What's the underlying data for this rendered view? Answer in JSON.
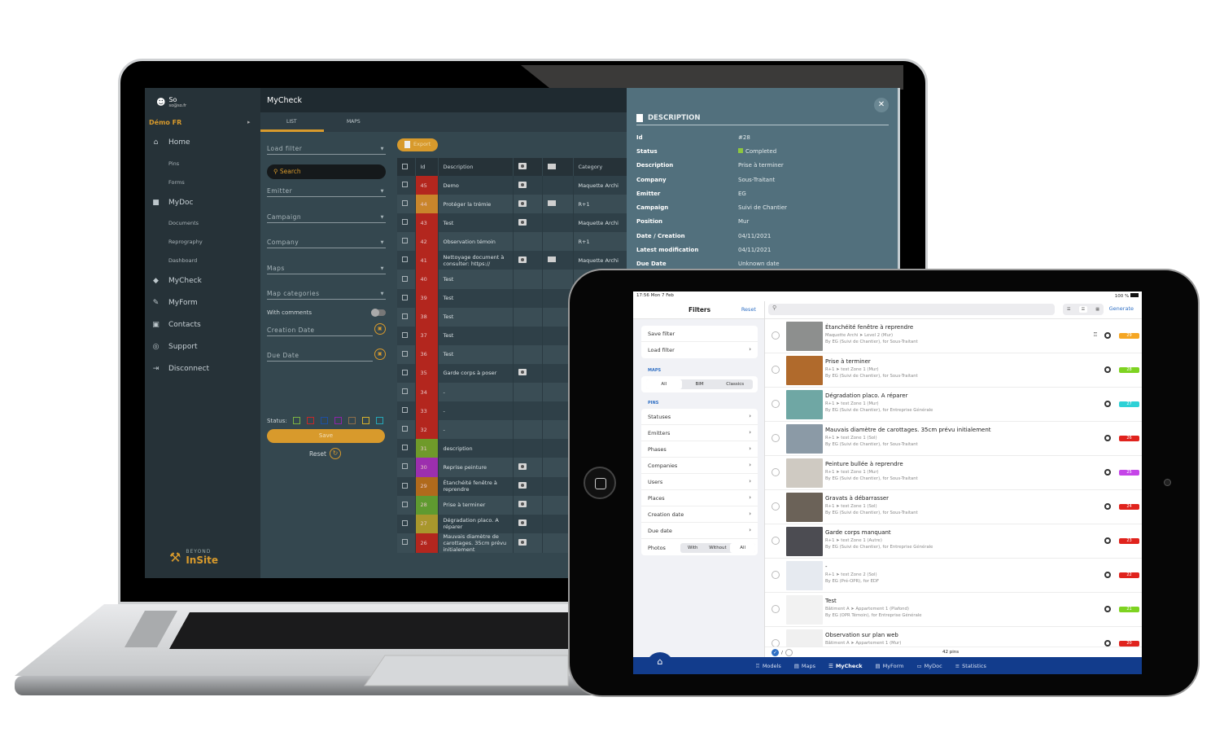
{
  "laptop": {
    "sidebar": {
      "user_name": "So",
      "user_email": "so@so.fr",
      "project": "Démo FR",
      "items": [
        {
          "label": "Home",
          "icon": "home-icon",
          "level": 0
        },
        {
          "label": "Pins",
          "level": 1
        },
        {
          "label": "Forms",
          "level": 1
        },
        {
          "label": "MyDoc",
          "icon": "folder-icon",
          "level": 0
        },
        {
          "label": "Documents",
          "level": 1
        },
        {
          "label": "Reprography",
          "level": 1
        },
        {
          "label": "Dashboard",
          "level": 1
        },
        {
          "label": "MyCheck",
          "icon": "shield-check-icon",
          "level": 0
        },
        {
          "label": "MyForm",
          "icon": "pencil-icon",
          "level": 0
        },
        {
          "label": "Contacts",
          "icon": "contact-card-icon",
          "level": 0
        },
        {
          "label": "Support",
          "icon": "lifebuoy-icon",
          "level": 0
        },
        {
          "label": "Disconnect",
          "icon": "logout-icon",
          "level": 0
        }
      ],
      "brand_top": "BEYOND",
      "brand_main": "InSite"
    },
    "header": {
      "title": "MyCheck"
    },
    "tabs": [
      {
        "label": "LIST",
        "active": true
      },
      {
        "label": "MAPS",
        "active": false
      }
    ],
    "filters": {
      "load_filter": "Load filter",
      "search_placeholder": "Search",
      "emitter": "Emitter",
      "campaign": "Campaign",
      "company": "Company",
      "maps": "Maps",
      "map_categories": "Map categories",
      "with_comments": "With comments",
      "creation_date": "Creation Date",
      "due_date": "Due Date",
      "status_label": "Status:",
      "status_colors": [
        "#7cb342",
        "#c62828",
        "#1e4fa3",
        "#8e24aa",
        "#8d6e4a",
        "#d8b12c",
        "#26a6b8"
      ],
      "save_label": "Save",
      "reset_label": "Reset"
    },
    "table": {
      "export_label": "Export",
      "columns": [
        "Id",
        "Description",
        "photo",
        "comment",
        "Category"
      ],
      "rows": [
        {
          "id": "45",
          "color": "#b3261e",
          "description": "Demo",
          "photo": true,
          "comment": false,
          "category": "Maquette Archi"
        },
        {
          "id": "44",
          "color": "#c9852b",
          "description": "Protéger la trémie",
          "photo": true,
          "comment": true,
          "category": "R+1"
        },
        {
          "id": "43",
          "color": "#b3261e",
          "description": "Test",
          "photo": true,
          "comment": false,
          "category": "Maquette Archi"
        },
        {
          "id": "42",
          "color": "#b3261e",
          "description": "Observation témoin",
          "photo": false,
          "comment": false,
          "category": "R+1"
        },
        {
          "id": "41",
          "color": "#b3261e",
          "description": "Nettoyage document à consulter: https://",
          "photo": true,
          "comment": true,
          "category": "Maquette Archi"
        },
        {
          "id": "40",
          "color": "#b3261e",
          "description": "Test",
          "photo": false,
          "comment": false,
          "category": ""
        },
        {
          "id": "39",
          "color": "#b3261e",
          "description": "Test",
          "photo": false,
          "comment": false,
          "category": ""
        },
        {
          "id": "38",
          "color": "#b3261e",
          "description": "Test",
          "photo": false,
          "comment": false,
          "category": ""
        },
        {
          "id": "37",
          "color": "#b3261e",
          "description": "Test",
          "photo": false,
          "comment": false,
          "category": ""
        },
        {
          "id": "36",
          "color": "#b3261e",
          "description": "Test",
          "photo": false,
          "comment": false,
          "category": ""
        },
        {
          "id": "35",
          "color": "#b3261e",
          "description": "Garde corps à poser",
          "photo": true,
          "comment": false,
          "category": ""
        },
        {
          "id": "34",
          "color": "#b3261e",
          "description": "-",
          "photo": false,
          "comment": false,
          "category": ""
        },
        {
          "id": "33",
          "color": "#b3261e",
          "description": "-",
          "photo": false,
          "comment": false,
          "category": ""
        },
        {
          "id": "32",
          "color": "#b3261e",
          "description": "-",
          "photo": false,
          "comment": false,
          "category": ""
        },
        {
          "id": "31",
          "color": "#6f9a2a",
          "description": "description",
          "photo": false,
          "comment": false,
          "category": ""
        },
        {
          "id": "30",
          "color": "#9c2fae",
          "description": "Reprise peinture",
          "photo": true,
          "comment": false,
          "category": ""
        },
        {
          "id": "29",
          "color": "#b06a1c",
          "description": "Étanchéité fenêtre à reprendre",
          "photo": true,
          "comment": false,
          "category": ""
        },
        {
          "id": "28",
          "color": "#5f9a30",
          "description": "Prise à terminer",
          "photo": true,
          "comment": false,
          "category": ""
        },
        {
          "id": "27",
          "color": "#a8972c",
          "description": "Dégradation placo. A réparer",
          "photo": true,
          "comment": false,
          "category": ""
        },
        {
          "id": "26",
          "color": "#b3261e",
          "description": "Mauvais diamètre de carottages. 35cm prévu initialement",
          "photo": true,
          "comment": false,
          "category": ""
        }
      ]
    },
    "description_panel": {
      "title": "DESCRIPTION",
      "fields": [
        {
          "key": "Id",
          "value": "#28"
        },
        {
          "key": "Status",
          "value": "Completed",
          "status_color": "#8dc63f"
        },
        {
          "key": "Description",
          "value": "Prise à terminer"
        },
        {
          "key": "Company",
          "value": "Sous-Traitant"
        },
        {
          "key": "Emitter",
          "value": "EG"
        },
        {
          "key": "Campaign",
          "value": "Suivi de Chantier"
        },
        {
          "key": "Position",
          "value": "Mur"
        },
        {
          "key": "Date / Creation",
          "value": "04/11/2021"
        },
        {
          "key": "Latest modification",
          "value": "04/11/2021"
        },
        {
          "key": "Due Date",
          "value": "Unknown date"
        }
      ]
    }
  },
  "ipad": {
    "status_time": "17:56  Mon 7 Feb",
    "battery": "100 %",
    "filters": {
      "title": "Filters",
      "reset": "Reset",
      "save_filter": "Save filter",
      "load_filter": "Load filter",
      "maps_section": "MAPS",
      "maps_options": [
        "All",
        "BIM",
        "Classics"
      ],
      "maps_selected": "All",
      "pins_section": "PINS",
      "pins_items": [
        "Statuses",
        "Emitters",
        "Phases",
        "Companies",
        "Users",
        "Places",
        "Creation date",
        "Due date"
      ],
      "photos_label": "Photos",
      "photos_options": [
        "With",
        "Without",
        "All"
      ],
      "photos_selected": "All"
    },
    "list": {
      "generate": "Generate",
      "items": [
        {
          "title": "Étanchéité fenêtre à reprendre",
          "location": "Maquette Archi ➤ Level 2 (Mur)",
          "by": "By EG (Suivi de Chantier), for Sous-Traitant",
          "badge": "29",
          "color": "#f5a623",
          "model": true,
          "thumb": "#8d8f8e"
        },
        {
          "title": "Prise à terminer",
          "location": "R+1 ➤ test Zone 1 (Mur)",
          "by": "By EG (Suivi de Chantier), for Sous-Traitant",
          "badge": "28",
          "color": "#7ed321",
          "model": false,
          "thumb": "#b06a2c"
        },
        {
          "title": "Dégradation placo. A réparer",
          "location": "R+1 ➤ test Zone 1 (Mur)",
          "by": "By EG (Suivi de Chantier), for Entreprise Générale",
          "badge": "27",
          "color": "#2ed1d6",
          "model": false,
          "thumb": "#6fa7a4"
        },
        {
          "title": "Mauvais diamètre de carottages. 35cm prévu initialement",
          "location": "R+1 ➤ test Zone 1 (Sol)",
          "by": "By EG (Suivi de Chantier), for Sous-Traitant",
          "badge": "26",
          "color": "#e0231d",
          "model": false,
          "thumb": "#8b9aa6"
        },
        {
          "title": "Peinture bullée à reprendre",
          "location": "R+1 ➤ test Zone 1 (Mur)",
          "by": "By EG (Suivi de Chantier), for Sous-Traitant",
          "badge": "25",
          "color": "#c545e8",
          "model": false,
          "thumb": "#cfcac2"
        },
        {
          "title": "Gravats à débarrasser",
          "location": "R+1 ➤ test Zone 1 (Sol)",
          "by": "By EG (Suivi de Chantier), for Sous-Traitant",
          "badge": "24",
          "color": "#e0231d",
          "model": false,
          "thumb": "#6b6258"
        },
        {
          "title": "Garde corps manquant",
          "location": "R+1 ➤ test Zone 1 (Autre)",
          "by": "By EG (Suivi de Chantier), for Entreprise Générale",
          "badge": "23",
          "color": "#e0231d",
          "model": false,
          "thumb": "#4c4c52"
        },
        {
          "title": "-",
          "location": "R+1 ➤ test Zone 2 (Sol)",
          "by": "By EG (Pré-OPR), for EDF",
          "badge": "22",
          "color": "#e0231d",
          "model": false,
          "thumb": "#e6eaf0"
        },
        {
          "title": "Test",
          "location": "Bâtiment A ➤ Appartement 1 (Plafond)",
          "by": "By EG (OPR Témoin), for Entreprise Générale",
          "badge": "21",
          "color": "#7ed321",
          "model": false,
          "thumb": "#f2f2f2"
        },
        {
          "title": "Observation sur plan web",
          "location": "Bâtiment A ➤ Appartement 1 (Mur)",
          "by": "",
          "badge": "20",
          "color": "#e0231d",
          "model": false,
          "thumb": "#f0f0f0"
        }
      ],
      "count": "42 pins"
    },
    "tabbar": [
      {
        "label": "Models",
        "icon": "building-icon",
        "active": false
      },
      {
        "label": "Maps",
        "icon": "map-icon",
        "active": false
      },
      {
        "label": "MyCheck",
        "icon": "list-icon",
        "active": true
      },
      {
        "label": "MyForm",
        "icon": "form-icon",
        "active": false
      },
      {
        "label": "MyDoc",
        "icon": "folder-icon",
        "active": false
      },
      {
        "label": "Statistics",
        "icon": "stats-icon",
        "active": false
      }
    ]
  }
}
